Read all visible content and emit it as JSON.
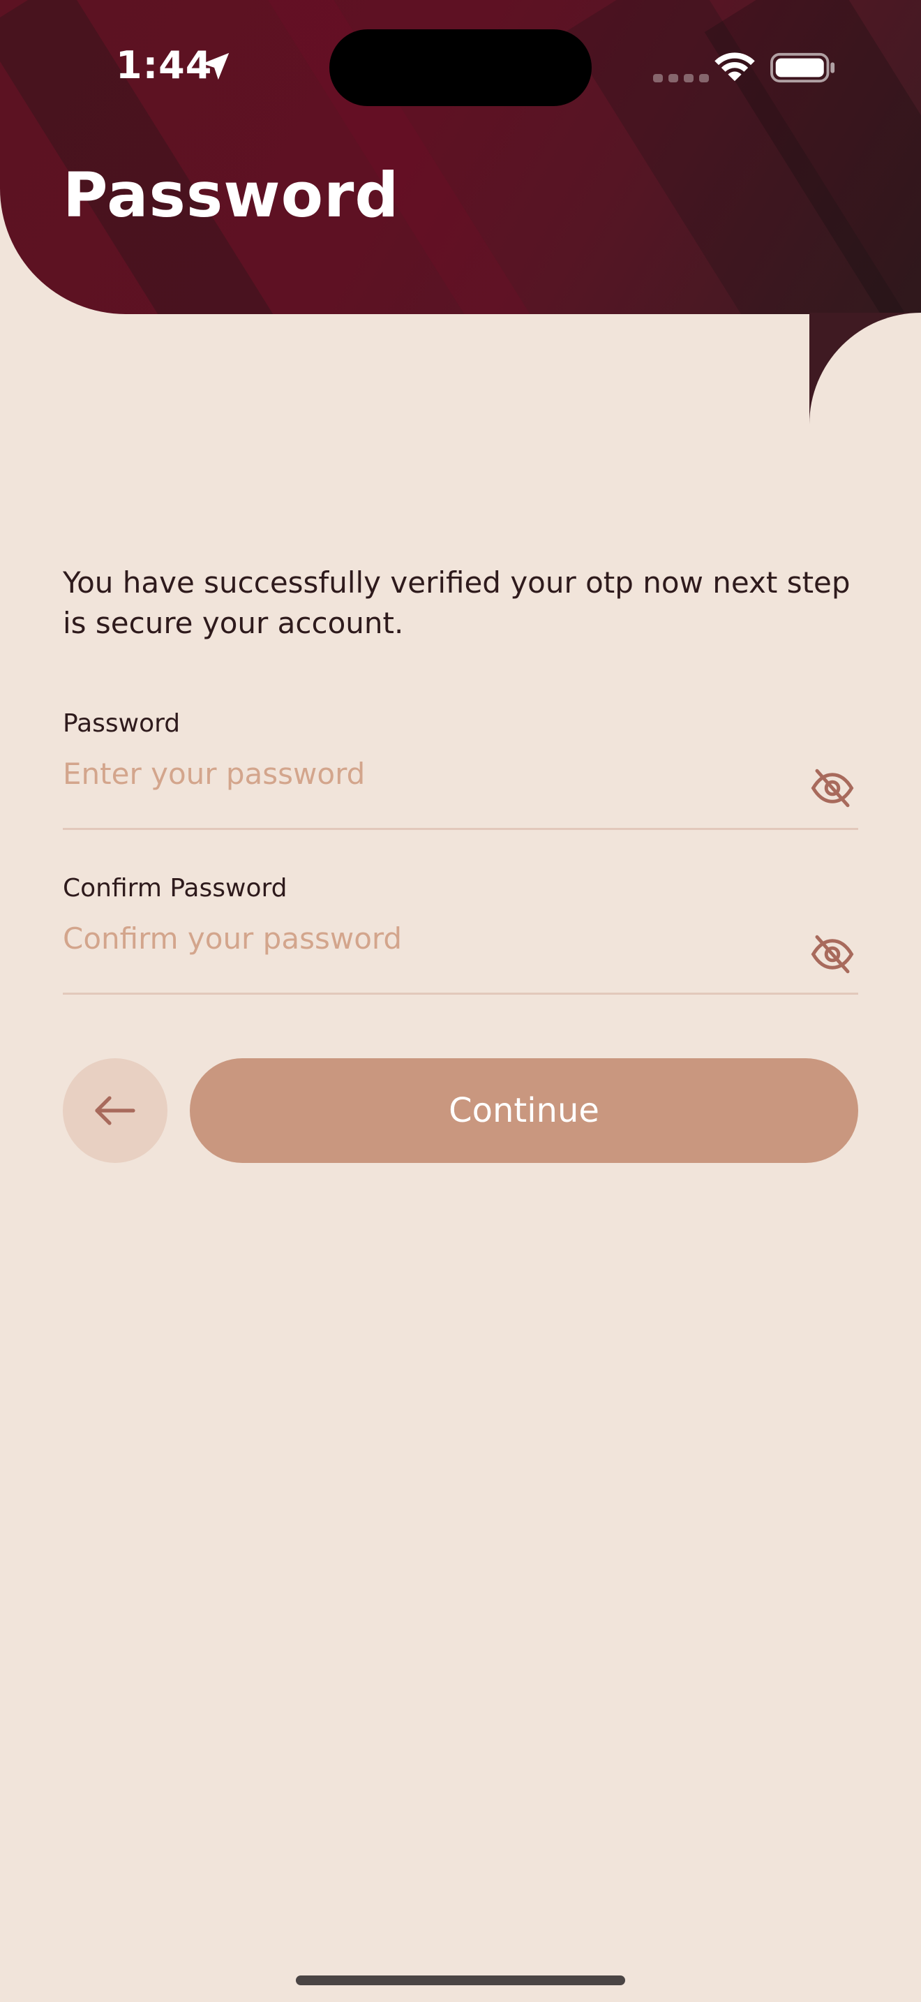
{
  "status_bar": {
    "time": "1:44"
  },
  "header": {
    "title": "Password"
  },
  "intro_text": "You have successfully verified your otp now next step is secure your account.",
  "password_field": {
    "label": "Password",
    "placeholder": "Enter your password",
    "toggle_icon": "eye-off-icon"
  },
  "confirm_field": {
    "label": "Confirm Password",
    "placeholder": "Confirm your password",
    "toggle_icon": "eye-off-icon"
  },
  "actions": {
    "back_icon": "arrow-left-icon",
    "continue_label": "Continue"
  },
  "colors": {
    "header_bg": "#5e1123",
    "page_bg": "#f1e4da",
    "primary_button": "#c9977f",
    "back_button_bg": "#e8d0c2",
    "placeholder": "#d3a58c",
    "icon": "#a86a5c"
  }
}
